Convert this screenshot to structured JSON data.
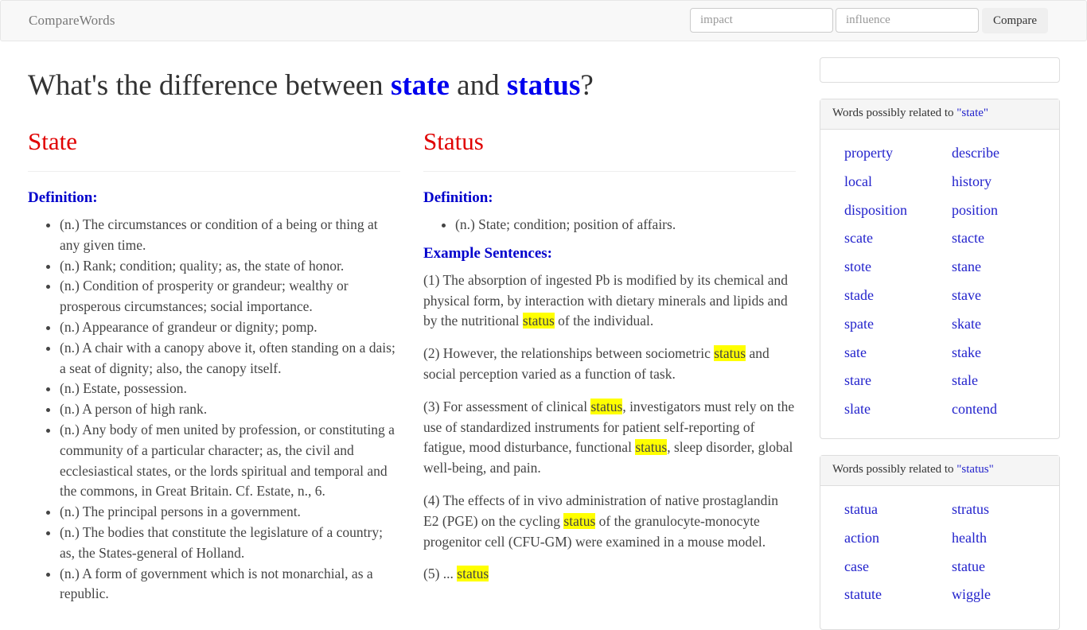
{
  "navbar": {
    "brand": "CompareWords",
    "input1_placeholder": "impact",
    "input2_placeholder": "influence",
    "compare_label": "Compare"
  },
  "page": {
    "title_prefix": "What's the difference between ",
    "word1": "state",
    "title_mid": " and ",
    "word2": "status",
    "title_suffix": "?"
  },
  "colA": {
    "heading": "State",
    "definition_label": "Definition:",
    "definitions": [
      "(n.) The circumstances or condition of a being or thing at any given time.",
      "(n.) Rank; condition; quality; as, the state of honor.",
      "(n.) Condition of prosperity or grandeur; wealthy or prosperous circumstances; social importance.",
      "(n.) Appearance of grandeur or dignity; pomp.",
      "(n.) A chair with a canopy above it, often standing on a dais; a seat of dignity; also, the canopy itself.",
      "(n.) Estate, possession.",
      "(n.) A person of high rank.",
      "(n.) Any body of men united by profession, or constituting a community of a particular character; as, the civil and ecclesiastical states, or the lords spiritual and temporal and the commons, in Great Britain. Cf. Estate, n., 6.",
      "(n.) The principal persons in a government.",
      "(n.) The bodies that constitute the legislature of a country; as, the States-general of Holland.",
      "(n.) A form of government which is not monarchial, as a republic."
    ]
  },
  "colB": {
    "heading": "Status",
    "definition_label": "Definition:",
    "definitions": [
      "(n.) State; condition; position of affairs."
    ],
    "examples_label": "Example Sentences:",
    "highlight": "status",
    "examples": [
      "(1) The absorption of ingested Pb is modified by its chemical and physical form, by interaction with dietary minerals and lipids and by the nutritional status of the individual.",
      "(2) However, the relationships between sociometric status and social perception varied as a function of task.",
      "(3) For assessment of clinical status, investigators must rely on the use of standardized instruments for patient self-reporting of fatigue, mood disturbance, functional status, sleep disorder, global well-being, and pain.",
      "(4) The effects of in vivo administration of native prostaglandin E2 (PGE) on the cycling status of the granulocyte-monocyte progenitor cell (CFU-GM) were examined in a mouse model.",
      "(5) ... status"
    ]
  },
  "sidebar": {
    "panelA": {
      "head_prefix": "Words possibly related to ",
      "word": "\"state\"",
      "words": [
        "property",
        "describe",
        "local",
        "history",
        "disposition",
        "position",
        "scate",
        "stacte",
        "stote",
        "stane",
        "stade",
        "stave",
        "spate",
        "skate",
        "sate",
        "stake",
        "stare",
        "stale",
        "slate",
        "contend"
      ]
    },
    "panelB": {
      "head_prefix": "Words possibly related to ",
      "word": "\"status\"",
      "words": [
        "statua",
        "stratus",
        "action",
        "health",
        "case",
        "statue",
        "statute",
        "wiggle"
      ]
    }
  }
}
